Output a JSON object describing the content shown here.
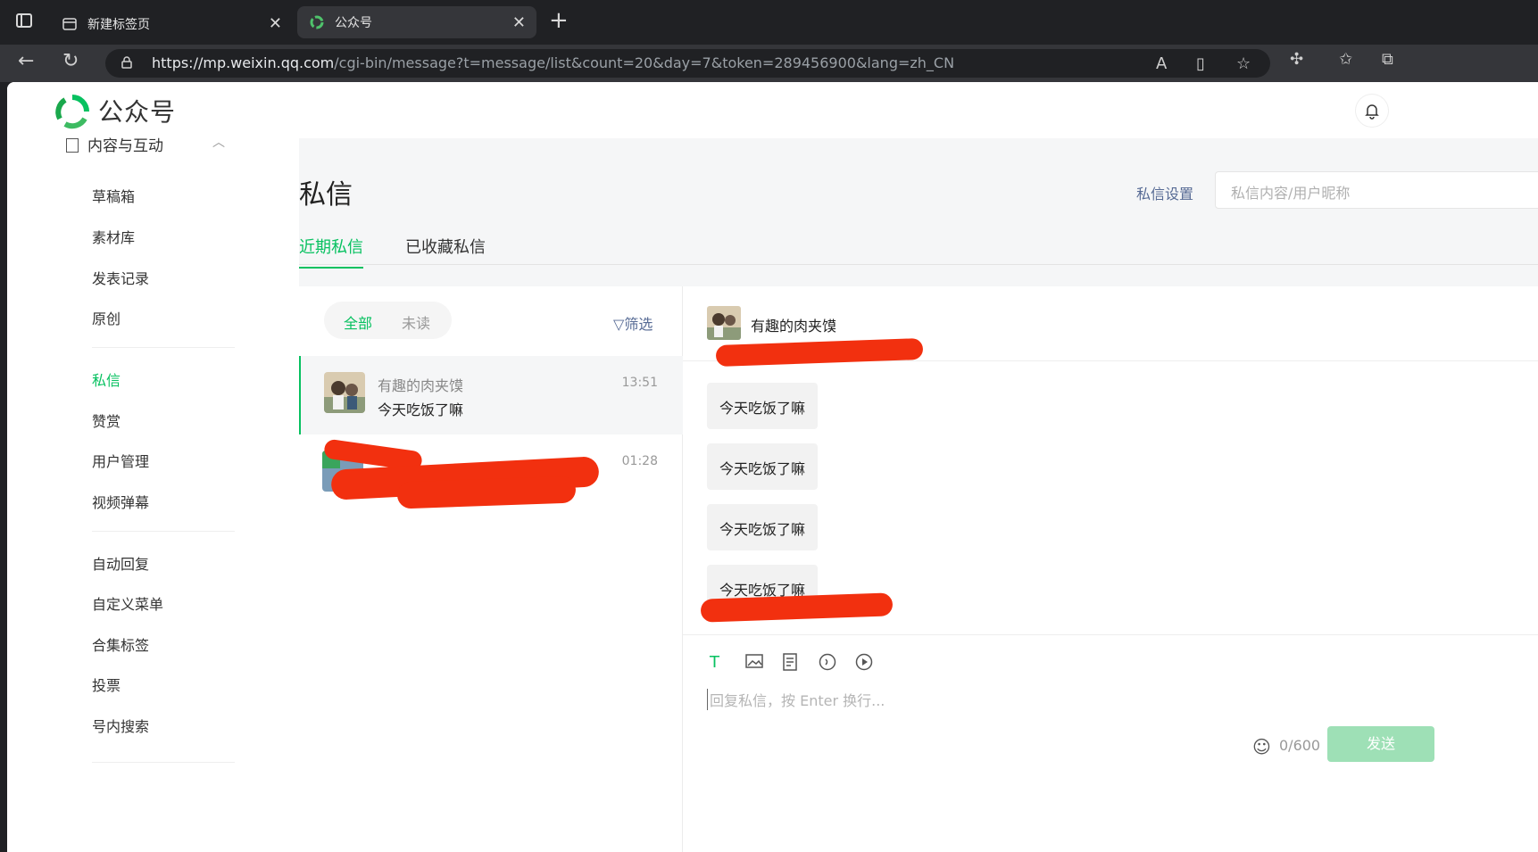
{
  "browser": {
    "tabs": [
      {
        "title": "新建标签页",
        "active": false
      },
      {
        "title": "公众号",
        "active": true
      }
    ],
    "url_host": "https://mp.weixin.qq.com",
    "url_path": "/cgi-bin/message?t=message/list&count=20&day=7&token=289456900&lang=zh_CN"
  },
  "header": {
    "logo_text": "公众号"
  },
  "sidebar": {
    "group_label": "内容与互动",
    "items": [
      {
        "label": "草稿箱"
      },
      {
        "label": "素材库"
      },
      {
        "label": "发表记录"
      },
      {
        "label": "原创"
      },
      {
        "label": "私信",
        "current": true
      },
      {
        "label": "赞赏"
      },
      {
        "label": "用户管理"
      },
      {
        "label": "视频弹幕"
      },
      {
        "label": "自动回复"
      },
      {
        "label": "自定义菜单"
      },
      {
        "label": "合集标签"
      },
      {
        "label": "投票"
      },
      {
        "label": "号内搜索"
      }
    ]
  },
  "main": {
    "title": "私信",
    "settings_label": "私信设置",
    "search_placeholder": "私信内容/用户昵称",
    "tabs": [
      {
        "label": "近期私信",
        "selected": true
      },
      {
        "label": "已收藏私信",
        "selected": false
      }
    ]
  },
  "conversations": {
    "filter_all": "全部",
    "filter_unread": "未读",
    "filter_button": "筛选",
    "items": [
      {
        "name": "有趣的肉夹馍",
        "last_message": "今天吃饭了嘛",
        "time": "13:51"
      },
      {
        "name": "",
        "last_message": "",
        "time": "01:28"
      }
    ]
  },
  "chat": {
    "contact_name": "有趣的肉夹馍",
    "messages": [
      "今天吃饭了嘛",
      "今天吃饭了嘛",
      "今天吃饭了嘛",
      "今天吃饭了嘛"
    ],
    "input_placeholder": "回复私信，按 Enter 换行...",
    "char_count": "0/600",
    "send_label": "发送"
  },
  "colors": {
    "accent": "#07c160",
    "link": "#576b95",
    "redaction": "#f2300f"
  }
}
